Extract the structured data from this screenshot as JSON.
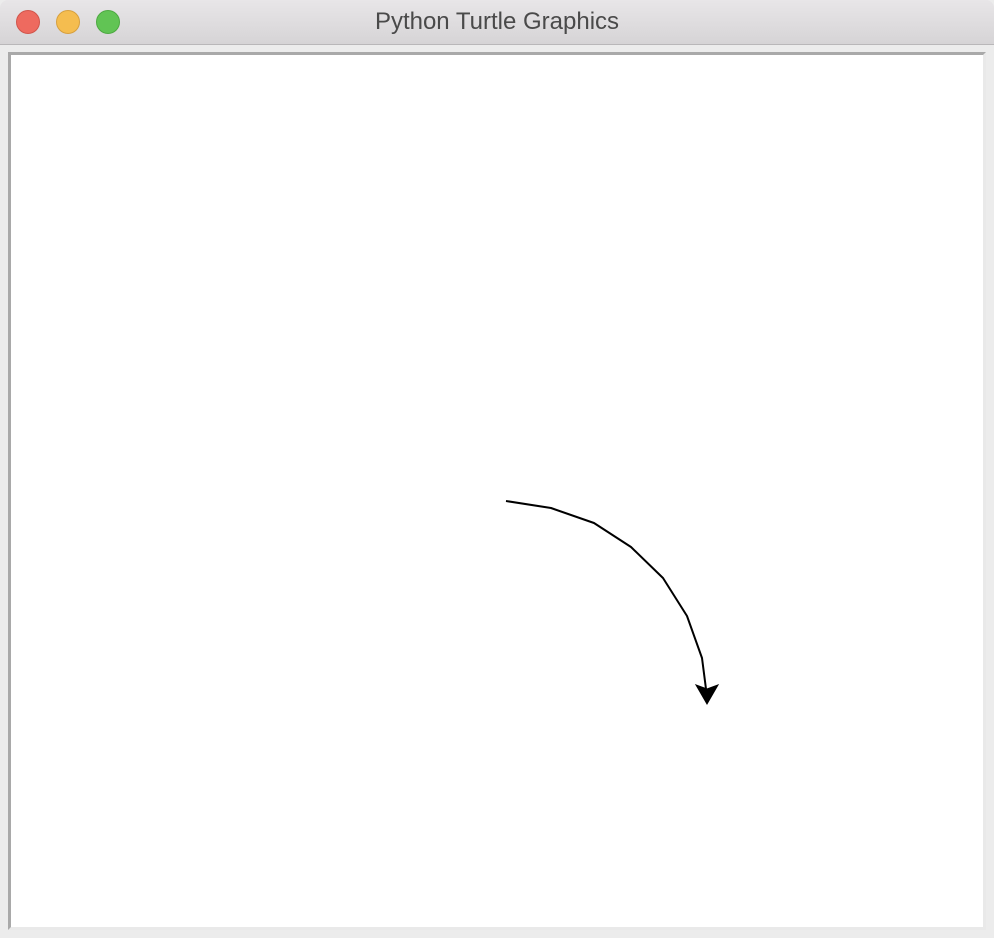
{
  "window": {
    "title": "Python Turtle Graphics"
  },
  "colors": {
    "pen": "#000000",
    "canvas_background": "#ffffff"
  },
  "turtle": {
    "shape": "classic-arrow-icon",
    "heading": "down"
  }
}
